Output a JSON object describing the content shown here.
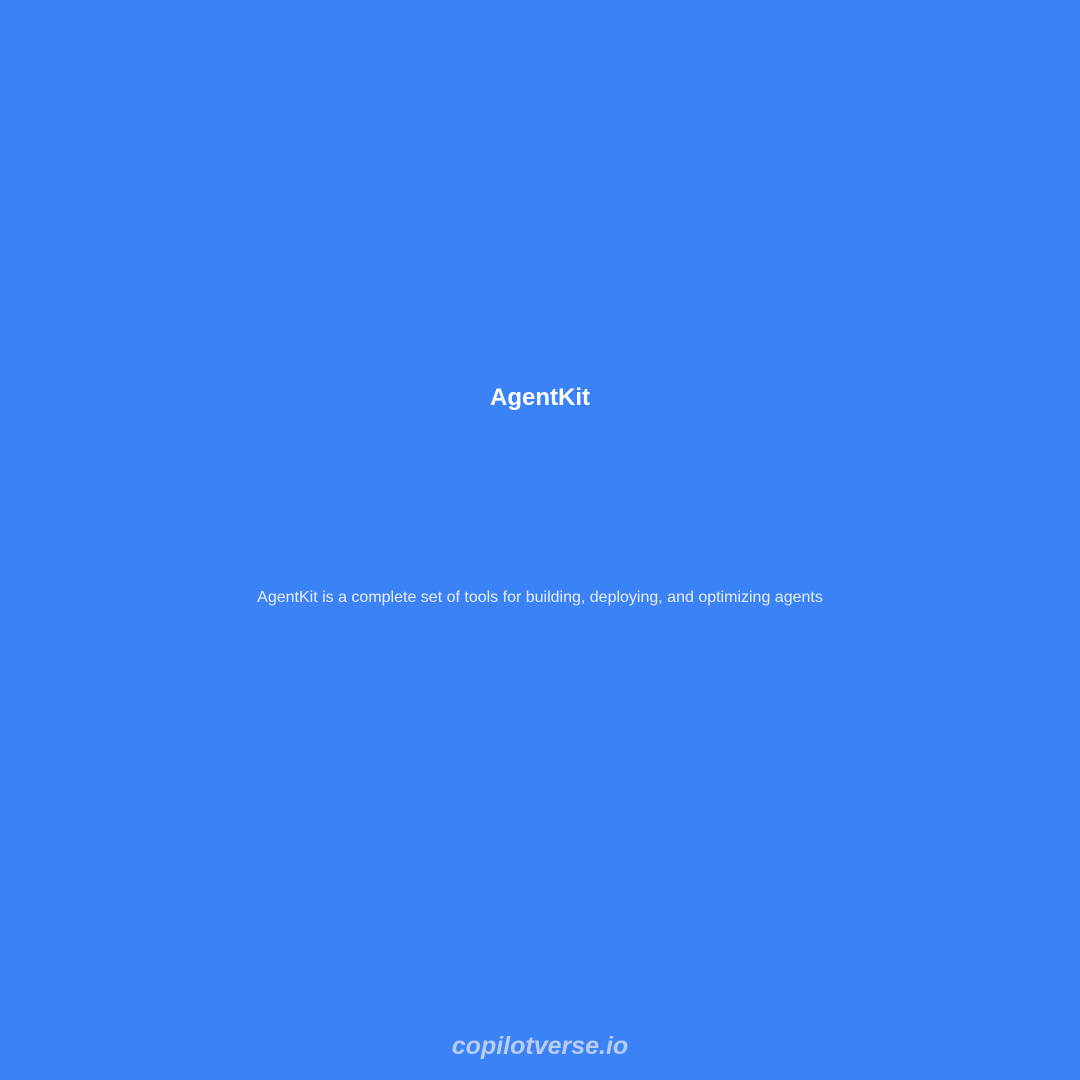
{
  "card": {
    "title": "AgentKit",
    "description": "AgentKit is a complete set of tools for building, deploying, and optimizing agents",
    "watermark": "copilotverse.io"
  },
  "colors": {
    "background": "#3b82f6",
    "title": "#ffffff",
    "description": "#e6edf9",
    "watermark": "#b7cdf3"
  }
}
